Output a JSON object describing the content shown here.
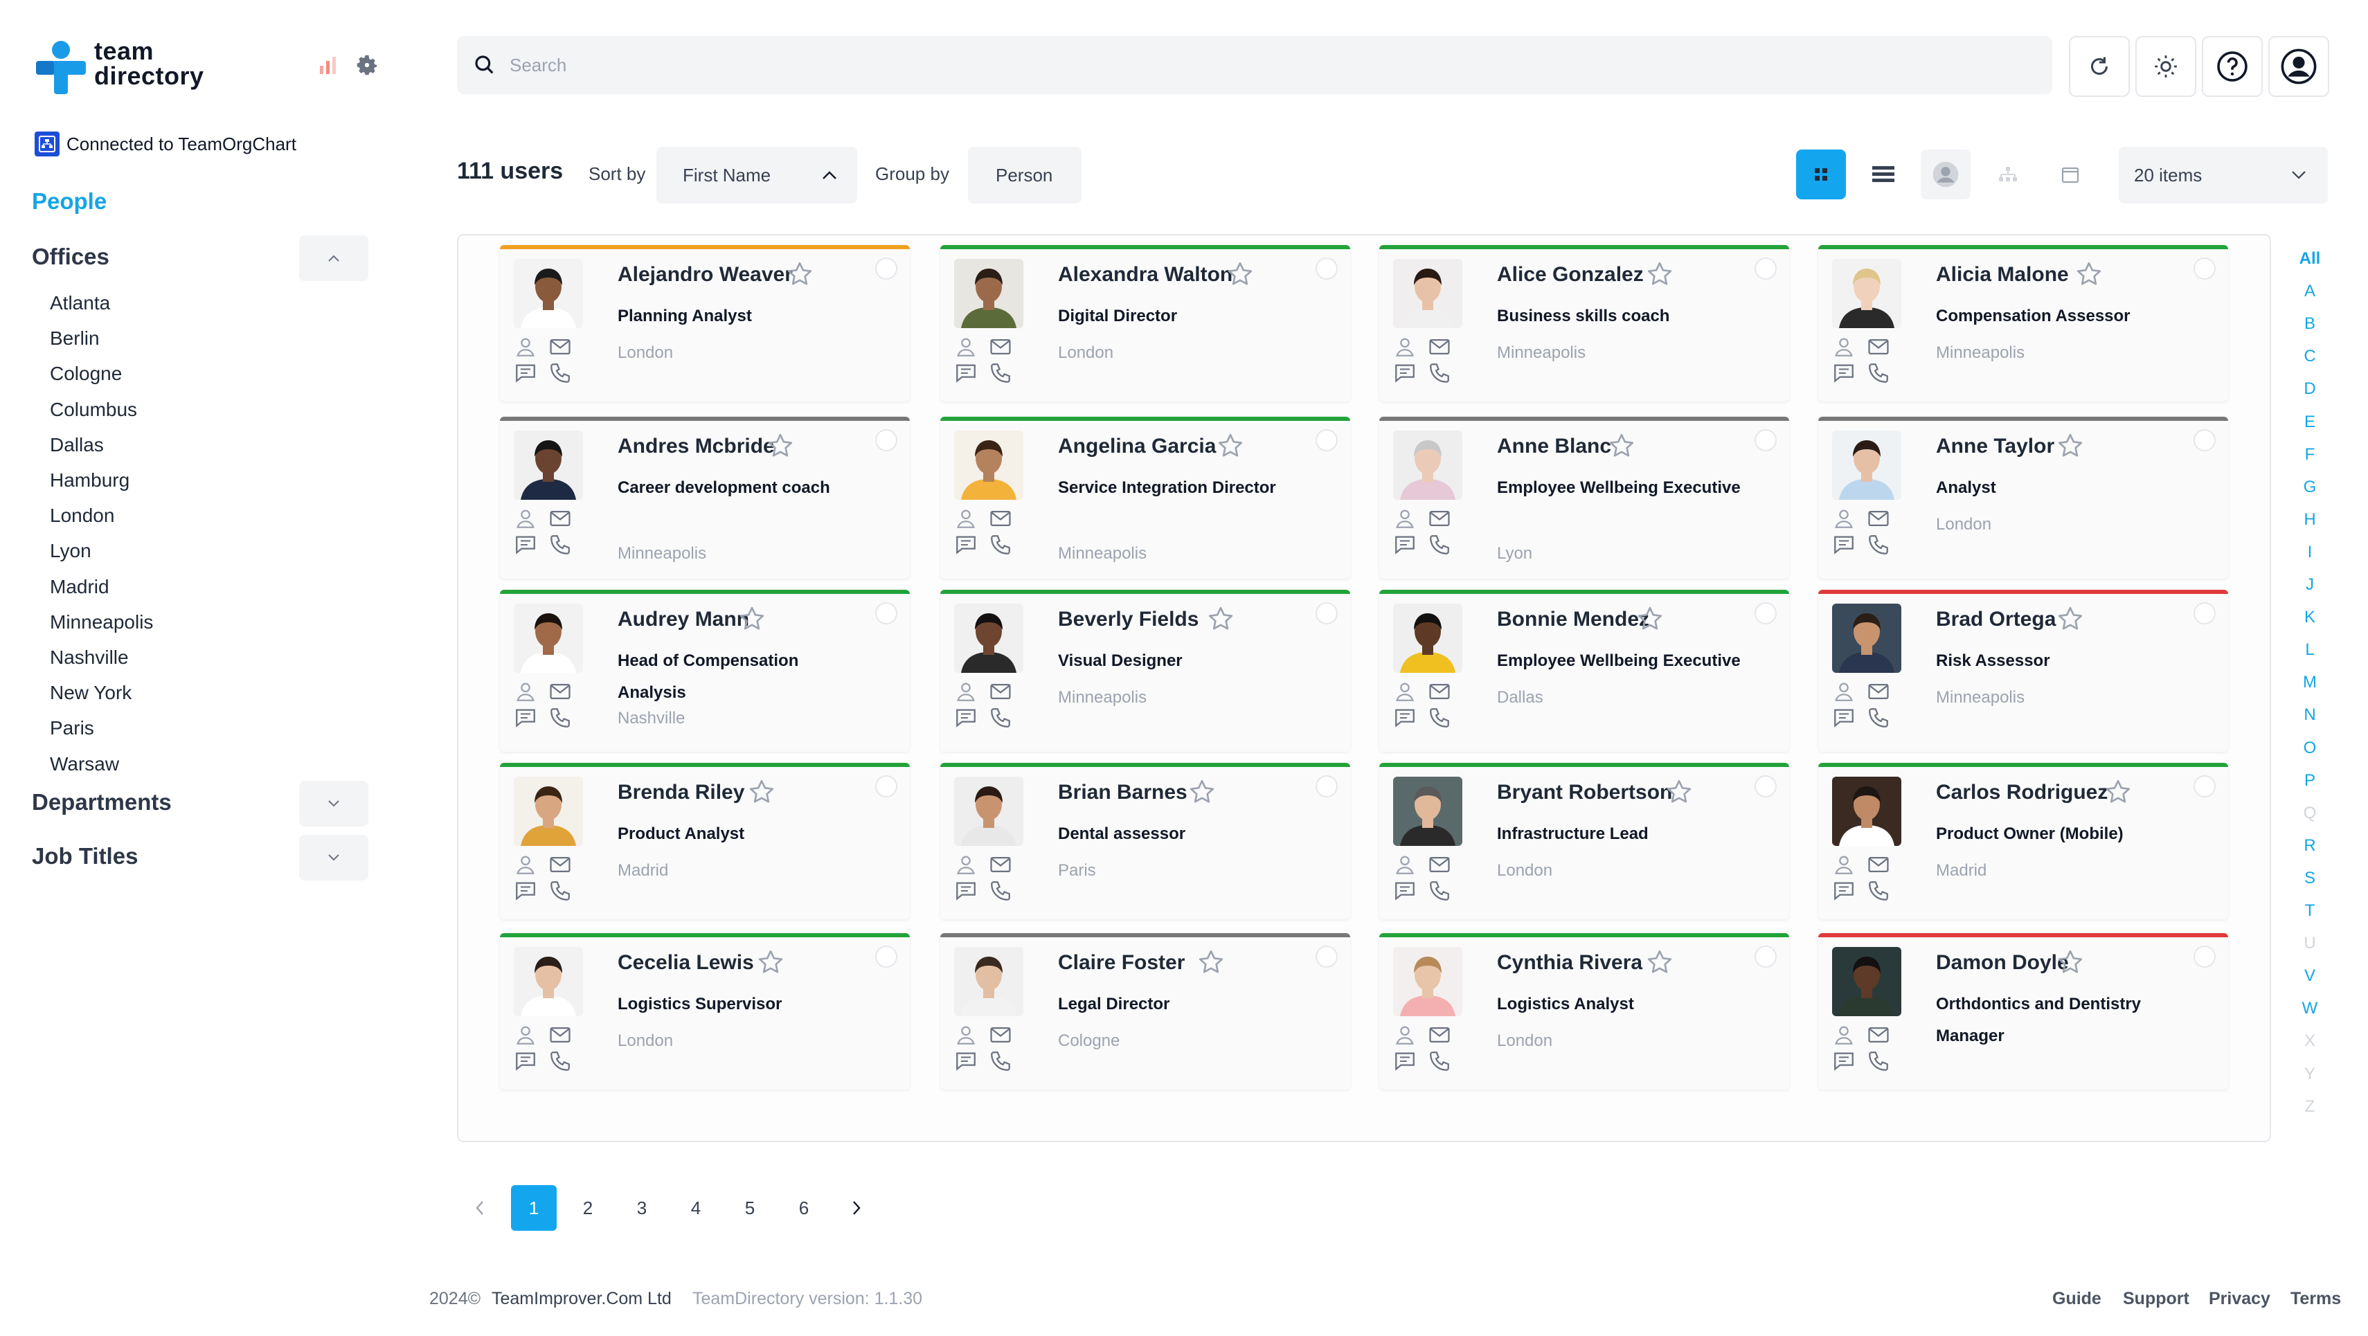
{
  "brand": {
    "line1": "team",
    "line2": "directory",
    "accent": "#1a9be8"
  },
  "sidebar": {
    "connected_label": "Connected to TeamOrgChart",
    "people_label": "People",
    "offices_label": "Offices",
    "offices": [
      "Atlanta",
      "Berlin",
      "Cologne",
      "Columbus",
      "Dallas",
      "Hamburg",
      "London",
      "Lyon",
      "Madrid",
      "Minneapolis",
      "Nashville",
      "New York",
      "Paris",
      "Warsaw"
    ],
    "departments_label": "Departments",
    "job_titles_label": "Job Titles"
  },
  "search": {
    "placeholder": "Search"
  },
  "controls": {
    "count": "111 users",
    "sort_label": "Sort by",
    "sort_value": "First Name",
    "group_label": "Group by",
    "group_value": "Person",
    "items_value": "20 items"
  },
  "cards": [
    {
      "name": "Alejandro Weaver",
      "title": "Planning Analyst",
      "location": "London",
      "bar": "#f0a020",
      "skin": "#8a5a3c",
      "hair": "#1b1b1b",
      "shirt": "#ffffff",
      "bg": "#f3f3f3"
    },
    {
      "name": "Alexandra Walton",
      "title": "Digital Director",
      "location": "London",
      "bar": "#22a33a",
      "skin": "#9a6a4a",
      "hair": "#2a1e16",
      "shirt": "#5b6b3a",
      "bg": "#e8e6e0"
    },
    {
      "name": "Alice Gonzalez",
      "title": "Business skills coach",
      "location": "Minneapolis",
      "bar": "#22a33a",
      "skin": "#e8c2a8",
      "hair": "#2a1a14",
      "shirt": "#f0f0f0",
      "bg": "#f0eeee"
    },
    {
      "name": "Alicia Malone",
      "title": "Compensation Assessor",
      "location": "Minneapolis",
      "bar": "#22a33a",
      "skin": "#f0d2bc",
      "hair": "#e0c58a",
      "shirt": "#2a2a2a",
      "bg": "#f2f2f2"
    },
    {
      "name": "Andres Mcbride",
      "title": "Career development coach",
      "location": "Minneapolis",
      "bar": "#777777",
      "skin": "#6a4430",
      "hair": "#151515",
      "shirt": "#1e2a44",
      "bg": "#f0f0f0"
    },
    {
      "name": "Angelina Garcia",
      "title": "Service Integration Director",
      "location": "Minneapolis",
      "bar": "#22a33a",
      "skin": "#b5825e",
      "hair": "#3a2414",
      "shirt": "#f3b23a",
      "bg": "#f5f0e8"
    },
    {
      "name": "Anne Blanc",
      "title": "Employee Wellbeing Executive",
      "location": "Lyon",
      "bar": "#777777",
      "skin": "#eccab8",
      "hair": "#c8c8c8",
      "shirt": "#e6c8d6",
      "bg": "#eeeeee"
    },
    {
      "name": "Anne Taylor",
      "title": "Analyst",
      "location": "London",
      "bar": "#777777",
      "skin": "#e6c0a6",
      "hair": "#2a1c14",
      "shirt": "#bcd6ee",
      "bg": "#eef2f5"
    },
    {
      "name": "Audrey Mann",
      "title": "Head of Compensation Analysis",
      "location": "Nashville",
      "bar": "#22a33a",
      "skin": "#a06a48",
      "hair": "#1a120c",
      "shirt": "#ffffff",
      "bg": "#f2f2f2"
    },
    {
      "name": "Beverly Fields",
      "title": "Visual Designer",
      "location": "Minneapolis",
      "bar": "#22a33a",
      "skin": "#6e4530",
      "hair": "#141010",
      "shirt": "#2a2a2a",
      "bg": "#f0f0f0"
    },
    {
      "name": "Bonnie Mendez",
      "title": "Employee Wellbeing Executive",
      "location": "Dallas",
      "bar": "#22a33a",
      "skin": "#5e3a26",
      "hair": "#121010",
      "shirt": "#f0c020",
      "bg": "#efefef"
    },
    {
      "name": "Brad Ortega",
      "title": "Risk Assessor",
      "location": "Minneapolis",
      "bar": "#e03a3a",
      "skin": "#c8946e",
      "hair": "#2a1e16",
      "shirt": "#2a3550",
      "bg": "#3a4a5a"
    },
    {
      "name": "Brenda Riley",
      "title": "Product Analyst",
      "location": "Madrid",
      "bar": "#22a33a",
      "skin": "#d8a680",
      "hair": "#3a2414",
      "shirt": "#e0a33a",
      "bg": "#f4f0ea"
    },
    {
      "name": "Brian Barnes",
      "title": "Dental assessor",
      "location": "Paris",
      "bar": "#22a33a",
      "skin": "#c89470",
      "hair": "#2a1c14",
      "shirt": "#e8e8e8",
      "bg": "#eeeeee"
    },
    {
      "name": "Bryant Robertson",
      "title": "Infrastructure Lead",
      "location": "London",
      "bar": "#22a33a",
      "skin": "#e0b89a",
      "hair": "#5a5a5a",
      "shirt": "#2a2a2a",
      "bg": "#5a6a6a"
    },
    {
      "name": "Carlos Rodriguez",
      "title": "Product Owner (Mobile)",
      "location": "Madrid",
      "bar": "#22a33a",
      "skin": "#c08a66",
      "hair": "#1e1612",
      "shirt": "#ffffff",
      "bg": "#3a2a22"
    },
    {
      "name": "Cecelia Lewis",
      "title": "Logistics Supervisor",
      "location": "London",
      "bar": "#22a33a",
      "skin": "#e6c0a4",
      "hair": "#2a1e18",
      "shirt": "#ffffff",
      "bg": "#f2f2f2"
    },
    {
      "name": "Claire Foster",
      "title": "Legal Director",
      "location": "Cologne",
      "bar": "#777777",
      "skin": "#e2bea2",
      "hair": "#3a2a20",
      "shirt": "#f2f2f2",
      "bg": "#f0f0f0"
    },
    {
      "name": "Cynthia Rivera",
      "title": "Logistics Analyst",
      "location": "London",
      "bar": "#22a33a",
      "skin": "#e8c4a8",
      "hair": "#b88a5a",
      "shirt": "#f4b0b0",
      "bg": "#f3efef"
    },
    {
      "name": "Damon Doyle",
      "title": "Orthdontics and Dentistry Manager",
      "location": "",
      "bar": "#e03a3a",
      "skin": "#5e3a28",
      "hair": "#121010",
      "shirt": "#2a3a30",
      "bg": "#2a3a3a"
    }
  ],
  "alphabet": [
    {
      "l": "All",
      "a": 1
    },
    {
      "l": "A",
      "a": 1
    },
    {
      "l": "B",
      "a": 1
    },
    {
      "l": "C",
      "a": 1
    },
    {
      "l": "D",
      "a": 1
    },
    {
      "l": "E",
      "a": 1
    },
    {
      "l": "F",
      "a": 1
    },
    {
      "l": "G",
      "a": 1
    },
    {
      "l": "H",
      "a": 1
    },
    {
      "l": "I",
      "a": 1
    },
    {
      "l": "J",
      "a": 1
    },
    {
      "l": "K",
      "a": 1
    },
    {
      "l": "L",
      "a": 1
    },
    {
      "l": "M",
      "a": 1
    },
    {
      "l": "N",
      "a": 1
    },
    {
      "l": "O",
      "a": 1
    },
    {
      "l": "P",
      "a": 1
    },
    {
      "l": "Q",
      "a": 0
    },
    {
      "l": "R",
      "a": 1
    },
    {
      "l": "S",
      "a": 1
    },
    {
      "l": "T",
      "a": 1
    },
    {
      "l": "U",
      "a": 0
    },
    {
      "l": "V",
      "a": 1
    },
    {
      "l": "W",
      "a": 1
    },
    {
      "l": "X",
      "a": 0
    },
    {
      "l": "Y",
      "a": 0
    },
    {
      "l": "Z",
      "a": 0
    }
  ],
  "pagination": {
    "pages": [
      "1",
      "2",
      "3",
      "4",
      "5",
      "6"
    ],
    "current": "1"
  },
  "footer": {
    "copyright": "2024©",
    "company": "TeamImprover.Com Ltd",
    "version": "TeamDirectory version: 1.1.30",
    "links": [
      "Guide",
      "Support",
      "Privacy",
      "Terms"
    ]
  },
  "colors": {
    "accent": "#13a6ef",
    "status_green": "#22a33a",
    "status_orange": "#f0a020",
    "status_red": "#e03a3a",
    "status_gray": "#777777"
  }
}
